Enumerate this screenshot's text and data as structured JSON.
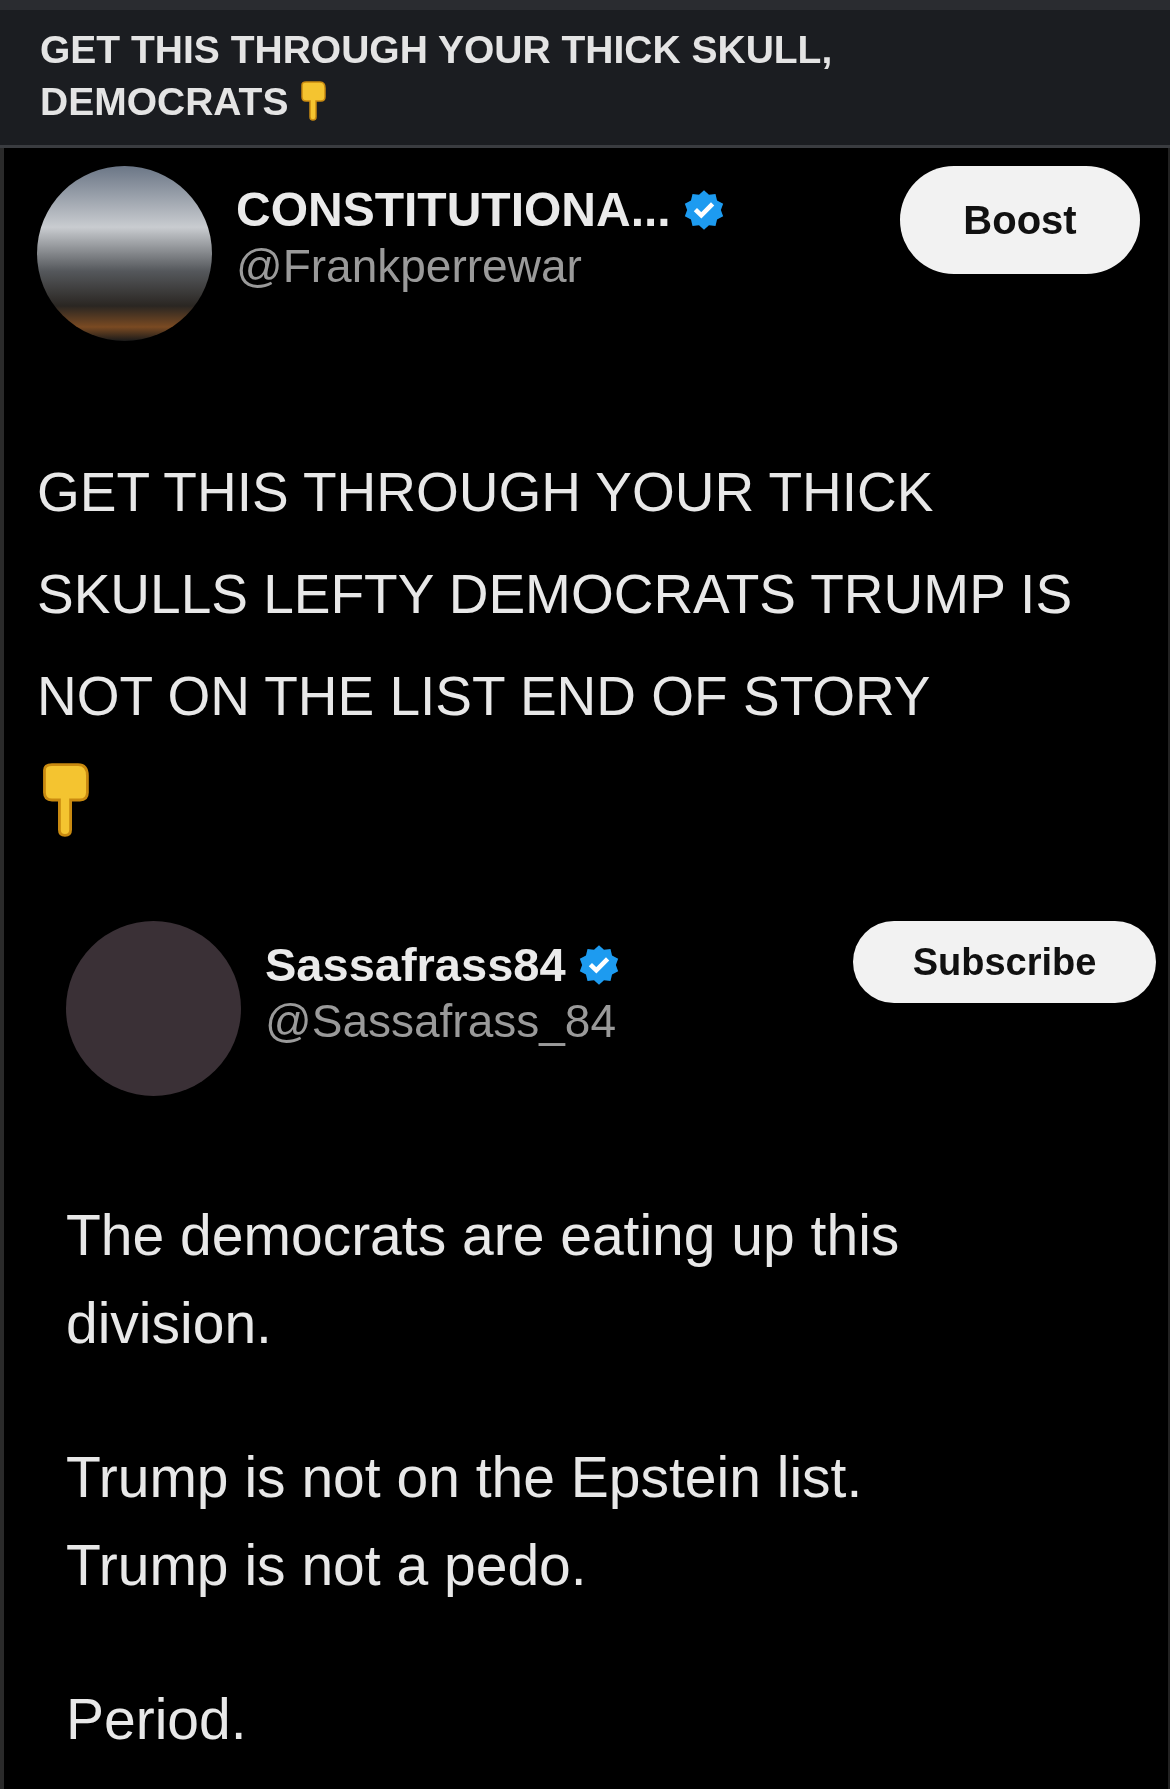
{
  "header": {
    "title": "GET THIS THROUGH YOUR THICK SKULL, DEMOCRATS",
    "pointing_hand": true
  },
  "posts": [
    {
      "kind": "original",
      "name": "CONSTITUTIONA...",
      "verified": true,
      "handle": "@Frankperrewar",
      "button": "Boost",
      "paragraphs": [
        "GET THIS THROUGH YOUR THICK SKULLS LEFTY DEMOCRATS TRUMP IS NOT ON THE LIST END OF STORY"
      ],
      "pointing_hand": true
    },
    {
      "kind": "quoted",
      "name": "Sassafrass84",
      "verified": true,
      "handle": "@Sassafrass_84",
      "button": "Subscribe",
      "paragraphs": [
        "The democrats are eating up this division.",
        "Trump is not on the Epstein list.\nTrump is not a pedo.",
        "Period."
      ],
      "pointing_hand": false
    }
  ]
}
